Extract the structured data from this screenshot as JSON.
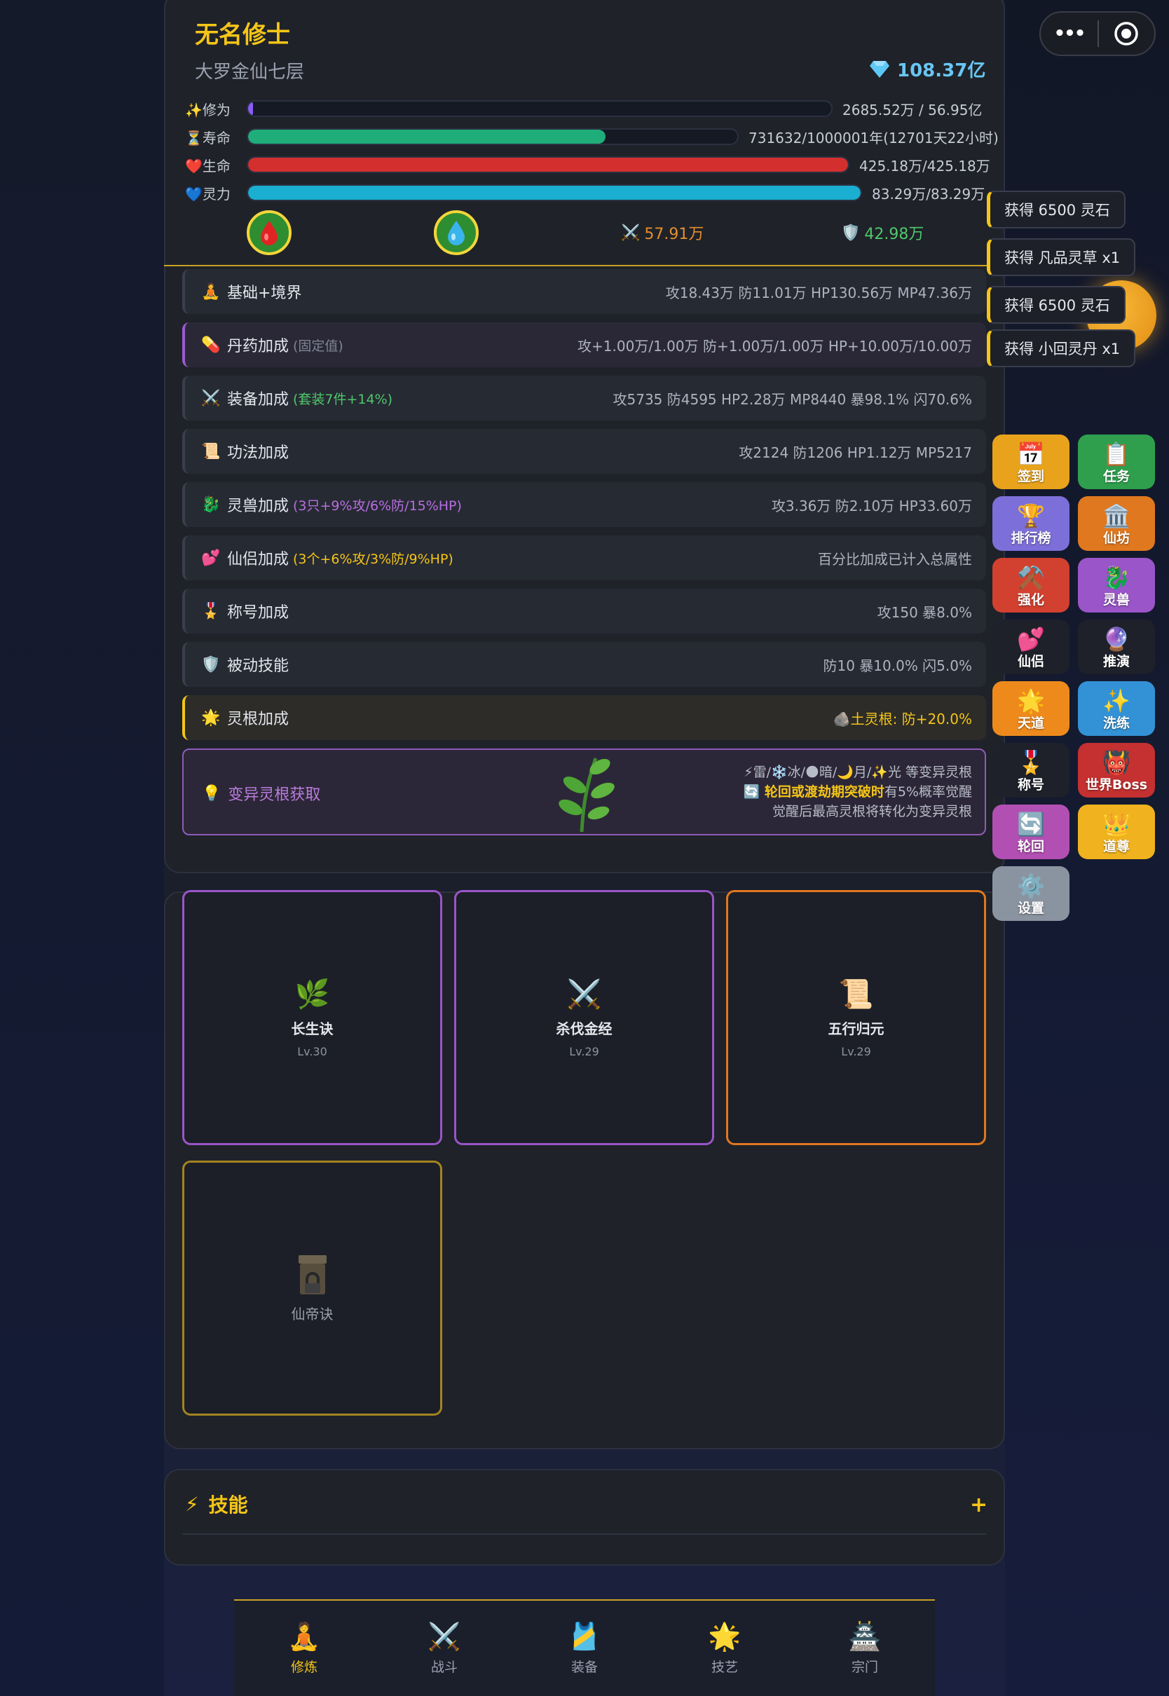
{
  "player": {
    "name": "无名修士",
    "realm": "大罗金仙七层",
    "spirit_stones": "108.37亿"
  },
  "stats": [
    {
      "icon": "✨",
      "label": "修为",
      "value": "2685.52万 / 56.95亿",
      "fill": 0.005,
      "color": "#8a5cf6"
    },
    {
      "icon": "⏳",
      "label": "寿命",
      "value": "731632/1000001年(12701天22小时)",
      "fill": 0.73,
      "color": "#1fae7a"
    },
    {
      "icon": "❤️",
      "label": "生命",
      "value": "425.18万/425.18万",
      "fill": 1.0,
      "color": "#d42f2f"
    },
    {
      "icon": "💙",
      "label": "灵力",
      "value": "83.29万/83.29万",
      "fill": 1.0,
      "color": "#1aaed0"
    }
  ],
  "combat": {
    "attack": "57.91万",
    "defense": "42.98万",
    "attack_color": "#e38f2c",
    "defense_color": "#4fc86a"
  },
  "bonuses": [
    {
      "icon": "🧘",
      "title": "基础+境界",
      "sub": "",
      "value": "攻18.43万 防11.01万 HP130.56万 MP47.36万"
    },
    {
      "icon": "💊",
      "title": "丹药加成",
      "sub": "(固定值)",
      "value": "攻+1.00万/1.00万 防+1.00万/1.00万 HP+10.00万/10.00万"
    },
    {
      "icon": "⚔️",
      "title": "装备加成",
      "sub": "(套装7件+14%)",
      "value": "攻5735 防4595 HP2.28万 MP8440 暴98.1% 闪70.6%"
    },
    {
      "icon": "📜",
      "title": "功法加成",
      "sub": "",
      "value": "攻2124 防1206 HP1.12万 MP5217"
    },
    {
      "icon": "🐉",
      "title": "灵兽加成",
      "sub": "(3只+9%攻/6%防/15%HP)",
      "value": "攻3.36万 防2.10万 HP33.60万"
    },
    {
      "icon": "💕",
      "title": "仙侣加成",
      "sub": "(3个+6%攻/3%防/9%HP)",
      "value": "百分比加成已计入总属性"
    },
    {
      "icon": "🎖️",
      "title": "称号加成",
      "sub": "",
      "value": "攻150 暴8.0%"
    },
    {
      "icon": "🛡️",
      "title": "被动技能",
      "sub": "",
      "value": "防10 暴10.0% 闪5.0%"
    },
    {
      "icon": "🌟",
      "title": "灵根加成",
      "sub": "",
      "value": "🪨土灵根: 防+20.0%"
    }
  ],
  "variant": {
    "title": "变异灵根获取",
    "line1": "⚡雷/❄️冰/🌑暗/🌙月/✨光 等变异灵根",
    "line2_highlight": "🔄 轮回或渡劫期突破时",
    "line2_rest": "有5%概率觉醒",
    "line3": "觉醒后最高灵根将转化为变异灵根"
  },
  "techniques": [
    {
      "icon": "🌿",
      "name": "长生诀",
      "level": "Lv.30"
    },
    {
      "icon": "⚔️",
      "name": "杀伐金经",
      "level": "Lv.29"
    },
    {
      "icon": "📜",
      "name": "五行归元",
      "level": "Lv.29"
    },
    {
      "icon": "🔒",
      "name": "仙帝诀",
      "level": ""
    }
  ],
  "skills": {
    "title": "技能",
    "add": "+"
  },
  "nav": [
    {
      "icon": "🧘",
      "label": "修炼"
    },
    {
      "icon": "⚔️",
      "label": "战斗"
    },
    {
      "icon": "🎽",
      "label": "装备"
    },
    {
      "icon": "🌟",
      "label": "技艺"
    },
    {
      "icon": "🏯",
      "label": "宗门"
    }
  ],
  "toasts": [
    "获得 6500 灵石",
    "获得 凡品灵草 x1",
    "获得 6500 灵石",
    "获得 小回灵丹 x1"
  ],
  "side_buttons": [
    {
      "icon": "📅",
      "label": "签到",
      "color": "#e8a21c"
    },
    {
      "icon": "📋",
      "label": "任务",
      "color": "#2f9f4e"
    },
    {
      "icon": "🏆",
      "label": "排行榜",
      "color": "#7d6fd9"
    },
    {
      "icon": "🏛️",
      "label": "仙坊",
      "color": "#e0781f"
    },
    {
      "icon": "⚒️",
      "label": "强化",
      "color": "#d2412f"
    },
    {
      "icon": "🐉",
      "label": "灵兽",
      "color": "#9a55c9"
    },
    {
      "icon": "💕",
      "label": "仙侣",
      "color": "#1e212a"
    },
    {
      "icon": "🔮",
      "label": "推演",
      "color": "#1e212a"
    },
    {
      "icon": "🌟",
      "label": "天道",
      "color": "#ee8a1c"
    },
    {
      "icon": "✨",
      "label": "洗练",
      "color": "#3392d6"
    },
    {
      "icon": "🎖️",
      "label": "称号",
      "color": "#1e212a"
    },
    {
      "icon": "👹",
      "label": "世界Boss",
      "color": "#c53030"
    },
    {
      "icon": "🔄",
      "label": "轮回",
      "color": "#b24fb3"
    },
    {
      "icon": "👑",
      "label": "道尊",
      "color": "#f0b21e"
    },
    {
      "icon": "⚙️",
      "label": "设置",
      "color": "#8a94a0"
    }
  ]
}
